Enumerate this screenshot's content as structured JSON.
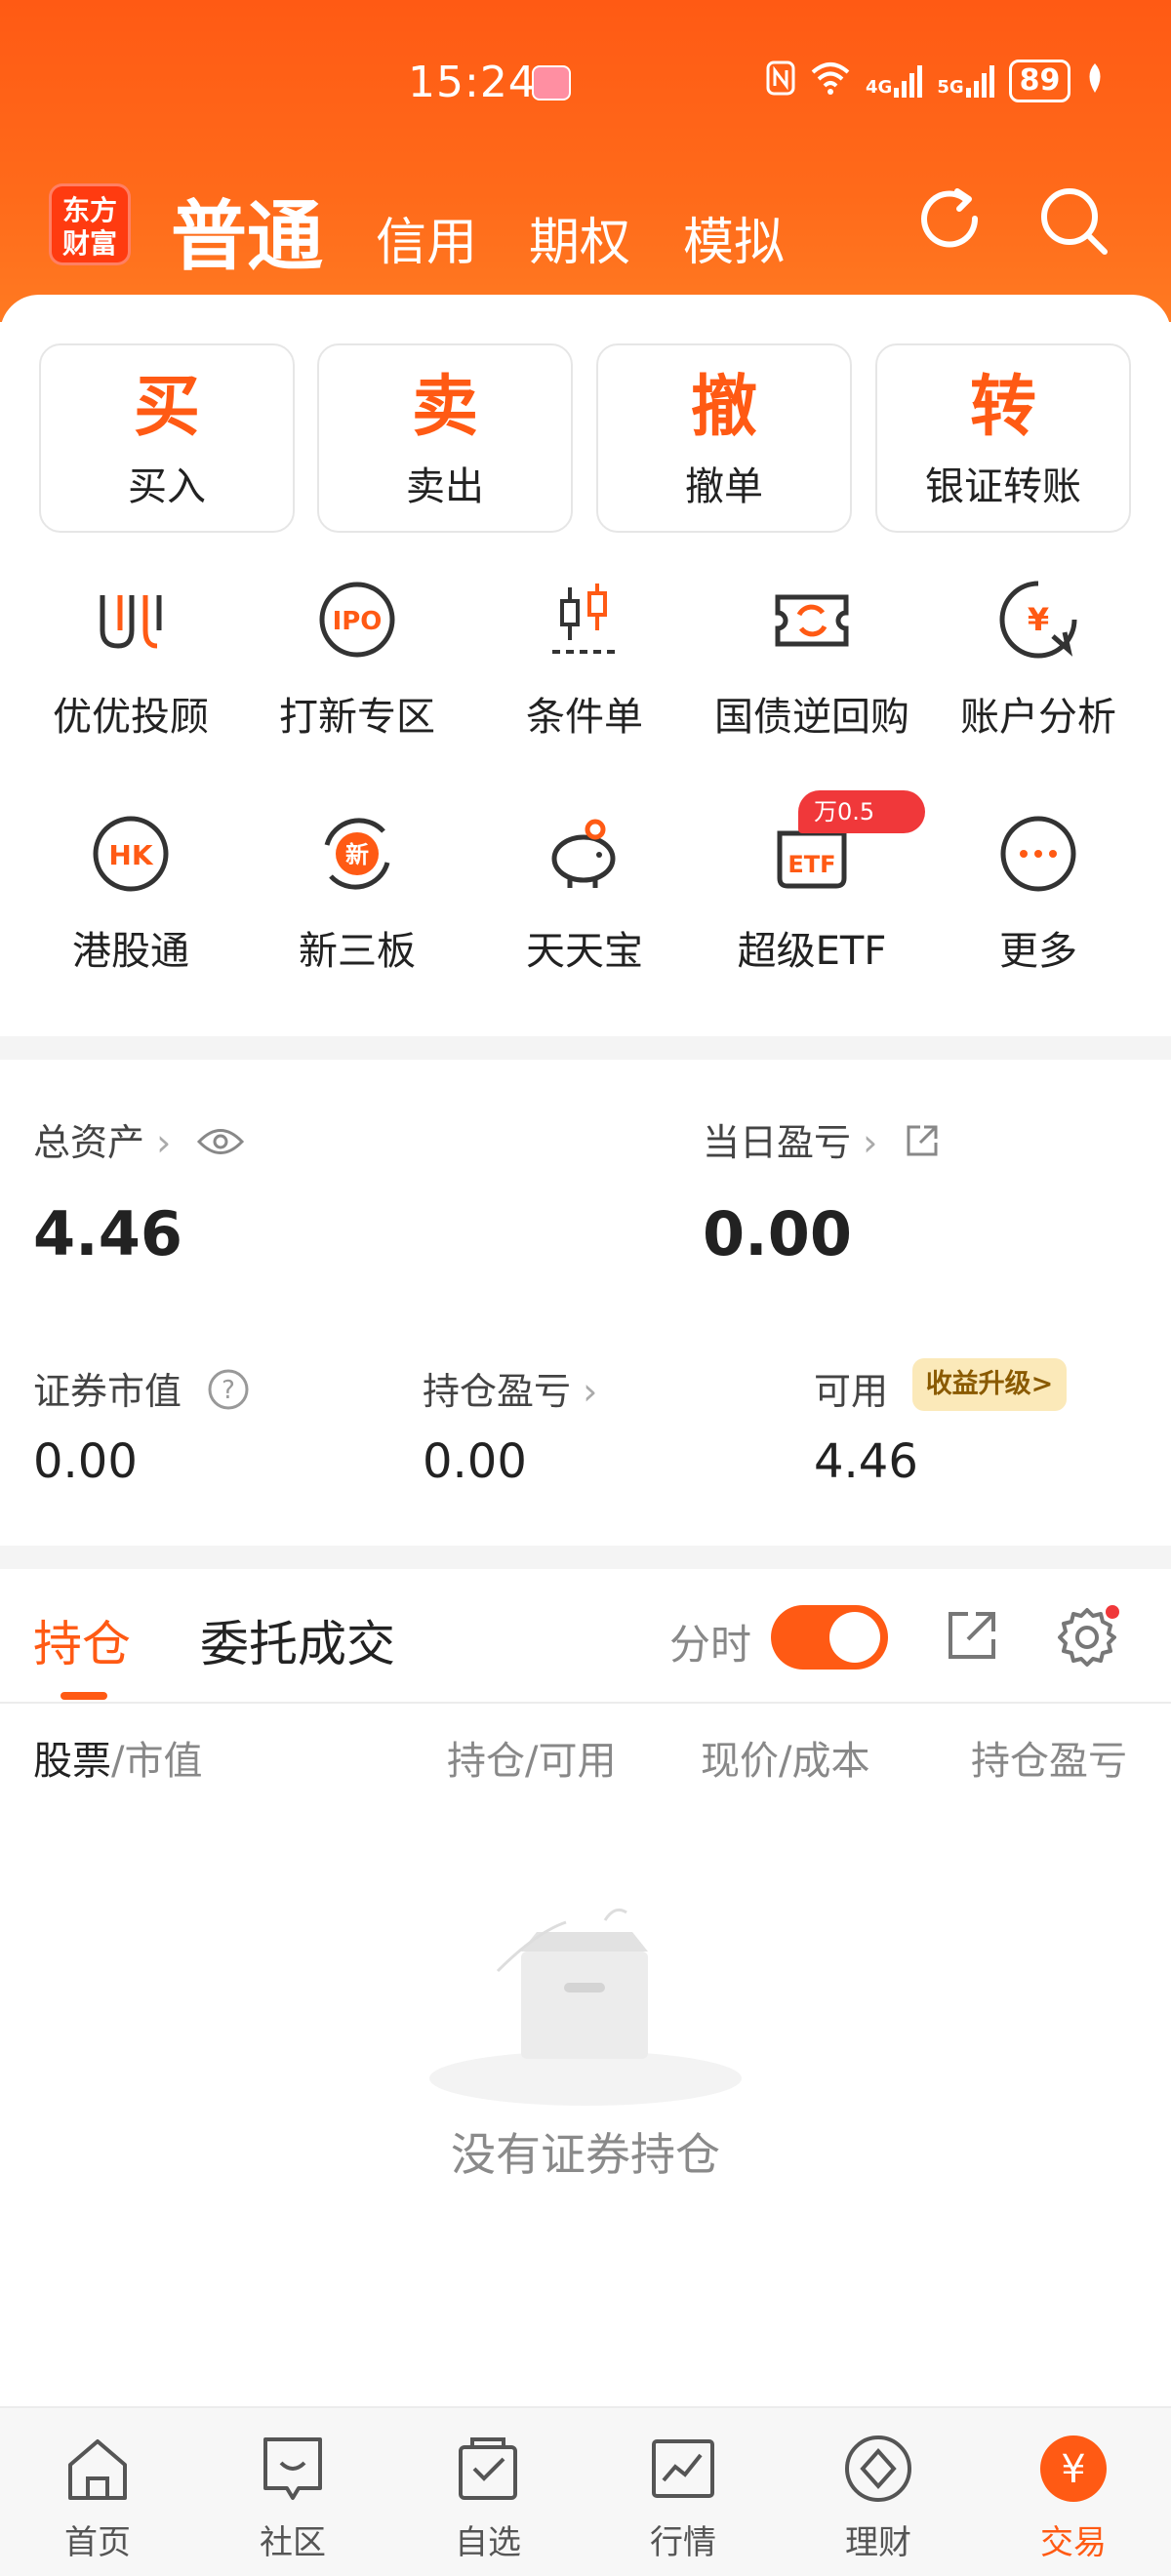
{
  "status": {
    "time": "15:24",
    "battery": "89",
    "net1": "4G",
    "net2": "5G"
  },
  "logo": {
    "line1": "东方",
    "line2": "财富"
  },
  "nav": {
    "main": "普通",
    "tabs": [
      "信用",
      "期权",
      "模拟"
    ]
  },
  "actions": [
    {
      "glyph": "买",
      "label": "买入"
    },
    {
      "glyph": "卖",
      "label": "卖出"
    },
    {
      "glyph": "撤",
      "label": "撤单"
    },
    {
      "glyph": "转",
      "label": "银证转账"
    }
  ],
  "grid_row1": [
    {
      "label": "优优投顾",
      "icon": "uu-advisor-icon"
    },
    {
      "label": "打新专区",
      "icon": "ipo-icon"
    },
    {
      "label": "条件单",
      "icon": "candlestick-icon"
    },
    {
      "label": "国债逆回购",
      "icon": "repo-ticket-icon"
    },
    {
      "label": "账户分析",
      "icon": "account-analysis-icon"
    }
  ],
  "grid_row2": [
    {
      "label": "港股通",
      "icon": "hk-icon"
    },
    {
      "label": "新三板",
      "icon": "new-board-icon"
    },
    {
      "label": "天天宝",
      "icon": "piggy-bank-icon"
    },
    {
      "label": "超级ETF",
      "icon": "etf-icon"
    },
    {
      "label": "更多",
      "icon": "more-icon"
    }
  ],
  "etf_badge": "万0.5",
  "assets": {
    "total_label": "总资产",
    "total_value": "4.46",
    "daily_label": "当日盈亏",
    "daily_value": "0.00",
    "market_label": "证券市值",
    "market_value": "0.00",
    "position_label": "持仓盈亏",
    "position_value": "0.00",
    "available_label": "可用",
    "available_value": "4.46",
    "upgrade_badge": "收益升级>"
  },
  "holdings": {
    "tab_active": "持仓",
    "tab_other": "委托成交",
    "toggle_label": "分时",
    "columns": [
      "股票",
      "/市值",
      "持仓/可用",
      "现价/成本",
      "持仓盈亏"
    ],
    "empty_text": "没有证券持仓"
  },
  "bottom_nav": [
    {
      "label": "首页",
      "icon": "home-icon"
    },
    {
      "label": "社区",
      "icon": "community-icon"
    },
    {
      "label": "自选",
      "icon": "watchlist-icon"
    },
    {
      "label": "行情",
      "icon": "market-chart-icon"
    },
    {
      "label": "理财",
      "icon": "finance-diamond-icon"
    },
    {
      "label": "交易",
      "icon": "trade-yen-icon"
    }
  ],
  "colors": {
    "accent": "#ff5a14",
    "badge_red": "#f0383a",
    "upgrade_bg": "#fbe9b9"
  }
}
